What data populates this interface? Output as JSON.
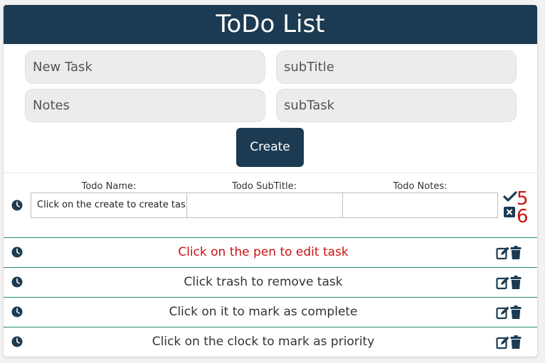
{
  "header": {
    "title": "ToDo List"
  },
  "form": {
    "new_task_placeholder": "New Task",
    "subtitle_placeholder": "subTitle",
    "notes_placeholder": "Notes",
    "subtask_placeholder": "subTask",
    "create_label": "Create"
  },
  "edit_row": {
    "name_label": "Todo Name:",
    "subtitle_label": "Todo SubTitle:",
    "notes_label": "Todo Notes:",
    "name_value": "Click on the create to create tas",
    "subtitle_value": "",
    "notes_value": "",
    "confirm_count": "5",
    "cancel_count": "6"
  },
  "tasks": [
    {
      "text": "Click on the pen to edit task",
      "highlighted": true
    },
    {
      "text": "Click trash to remove task",
      "highlighted": false
    },
    {
      "text": "Click on it to mark as complete",
      "highlighted": false
    },
    {
      "text": "Click on the clock to mark as priority",
      "highlighted": false
    }
  ],
  "colors": {
    "header_bg": "#1c3b52",
    "divider": "#2a8a7a",
    "highlight_text": "#cc1111"
  },
  "icons": [
    "clock-icon",
    "check-icon",
    "x-square-icon",
    "edit-icon",
    "trash-icon"
  ]
}
